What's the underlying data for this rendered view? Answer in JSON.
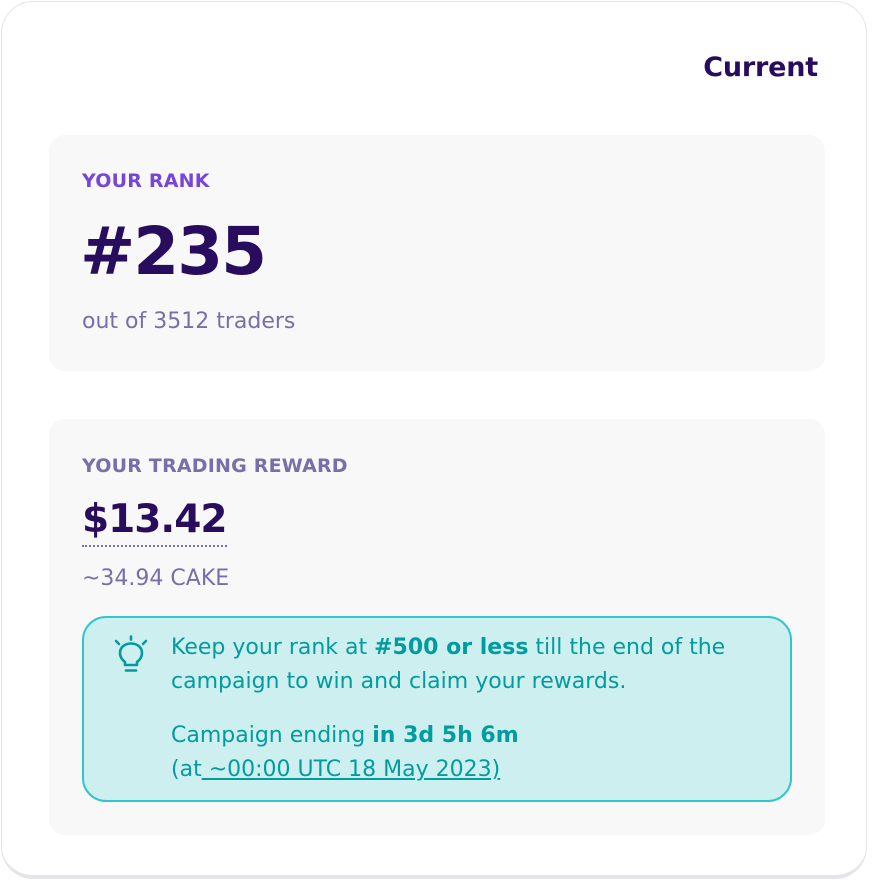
{
  "header": {
    "title": "Current"
  },
  "rank": {
    "label": "YOUR RANK",
    "value": "#235",
    "subtitle": "out of 3512 traders"
  },
  "reward": {
    "label": "YOUR TRADING REWARD",
    "usd_value": "$13.42",
    "cake_value": "~34.94 CAKE"
  },
  "tip": {
    "icon": "lightbulb-icon",
    "line1_pre": "Keep your rank at ",
    "line1_bold": "#500 or less",
    "line1_post": " till the end of the campaign to win and claim your rewards.",
    "ending_pre": "Campaign ending ",
    "ending_bold": "in 3d 5h 6m",
    "date_open": "(at",
    "date_text": " ~00:00 UTC 18 May 2023)"
  },
  "colors": {
    "primary_text": "#280d5f",
    "secondary_text": "#7a6eaa",
    "accent_purple": "#7645d9",
    "teal_text": "#029c9e",
    "teal_bg": "#cdeff0",
    "teal_border": "#31c5d0"
  }
}
